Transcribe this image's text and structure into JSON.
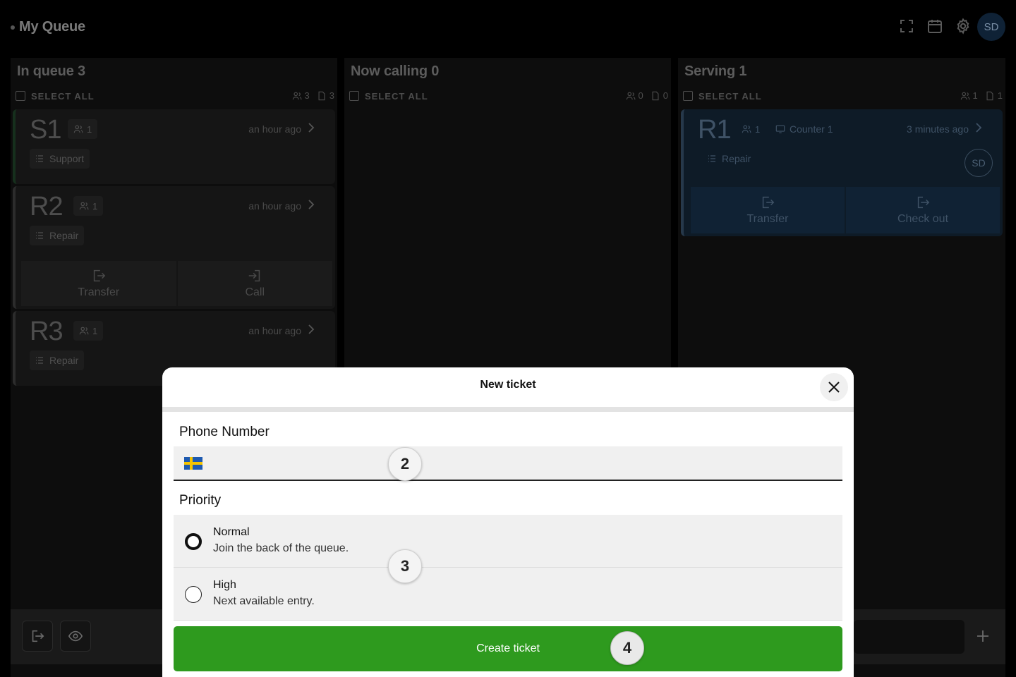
{
  "header": {
    "title": "My Queue",
    "avatar_initials": "SD",
    "icons": [
      "fullscreen-icon",
      "calendar-icon",
      "gear-icon"
    ]
  },
  "columns": [
    {
      "title": "In queue 3",
      "select_all": "SELECT ALL",
      "people_count": "3",
      "doc_count": "3",
      "tickets": [
        {
          "code": "S1",
          "people": "1",
          "time": "an hour ago",
          "service": "Support"
        },
        {
          "code": "R2",
          "people": "1",
          "time": "an hour ago",
          "service": "Repair",
          "actions": [
            "Transfer",
            "Call"
          ]
        },
        {
          "code": "R3",
          "people": "1",
          "time": "an hour ago",
          "service": "Repair"
        }
      ]
    },
    {
      "title": "Now calling 0",
      "select_all": "SELECT ALL",
      "people_count": "0",
      "doc_count": "0",
      "tickets": []
    },
    {
      "title": "Serving 1",
      "select_all": "SELECT ALL",
      "people_count": "1",
      "doc_count": "1",
      "tickets": [
        {
          "code": "R1",
          "people": "1",
          "counter": "Counter 1",
          "time": "3 minutes ago",
          "service": "Repair",
          "served_by": "SD",
          "actions": [
            "Transfer",
            "Check out"
          ]
        }
      ]
    }
  ],
  "modal": {
    "title": "New ticket",
    "phone_label": "Phone Number",
    "phone_value": "",
    "phone_flag": "se-flag-icon",
    "priority_label": "Priority",
    "priority_options": [
      {
        "title": "Normal",
        "description": "Join the back of the queue.",
        "selected": true
      },
      {
        "title": "High",
        "description": "Next available entry.",
        "selected": false
      }
    ],
    "submit_label": "Create ticket"
  },
  "steps": [
    "2",
    "3",
    "4"
  ],
  "colors": {
    "accent_green": "#2e9a1e",
    "serving_blue": "#0e1b27",
    "sweden_blue": "#1e5ab0",
    "sweden_yellow": "#f5c400"
  }
}
